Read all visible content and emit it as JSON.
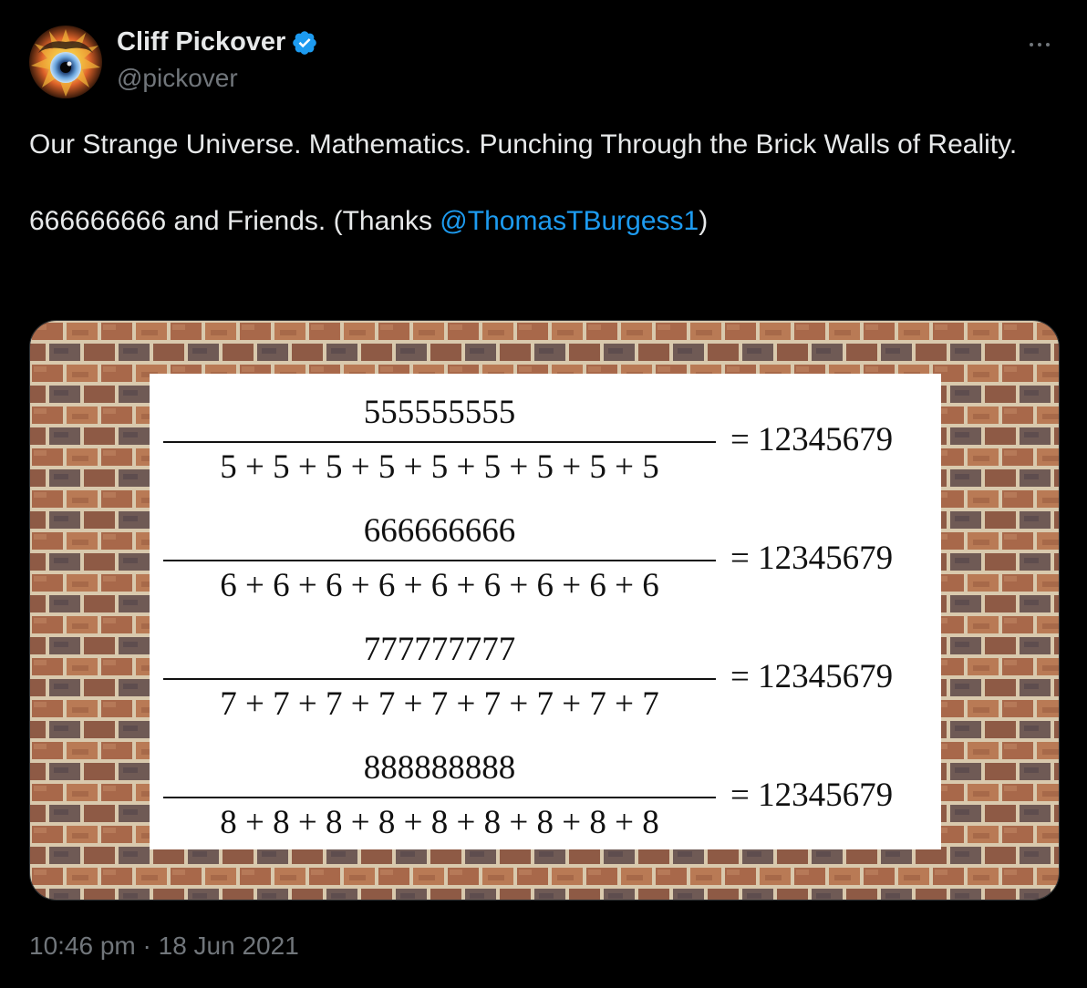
{
  "author": {
    "display_name": "Cliff Pickover",
    "handle": "@pickover",
    "verified": true
  },
  "tweet": {
    "line1": "Our Strange Universe. Mathematics.  Punching Through the Brick Walls of Reality.",
    "line2_text": "666666666 and Friends.  (Thanks ",
    "mention": "@ThomasTBurgess1",
    "line2_close": ")"
  },
  "media": {
    "equations": [
      {
        "numerator": "555555555",
        "denominator": "5 + 5 + 5 + 5 + 5 + 5 + 5 + 5 + 5",
        "result": "= 12345679"
      },
      {
        "numerator": "666666666",
        "denominator": "6 + 6 + 6 + 6 + 6 + 6 + 6 + 6 + 6",
        "result": "= 12345679"
      },
      {
        "numerator": "777777777",
        "denominator": "7 + 7 + 7 + 7 + 7 + 7 + 7 + 7 + 7",
        "result": "= 12345679"
      },
      {
        "numerator": "888888888",
        "denominator": "8 + 8 + 8 + 8 + 8 + 8 + 8 + 8 + 8",
        "result": "= 12345679"
      }
    ]
  },
  "timestamp": "10:46 pm · 18 Jun 2021",
  "colors": {
    "background": "#000000",
    "text": "#e7e9ea",
    "secondary": "#71767b",
    "link": "#1d9bf0",
    "verified": "#1d9bf0"
  },
  "icons": {
    "verified": "verified-badge-icon",
    "more": "more-dots-icon"
  }
}
